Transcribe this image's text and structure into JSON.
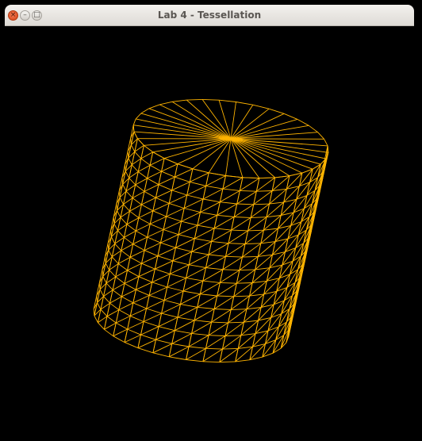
{
  "window": {
    "title": "Lab 4 - Tessellation",
    "controls": {
      "close_glyph": "×",
      "minimize_glyph": "–",
      "maximize_glyph": "□"
    }
  },
  "scene": {
    "background_color": "#000000",
    "wireframe_color": "#ffb400",
    "shape": "cylinder"
  }
}
